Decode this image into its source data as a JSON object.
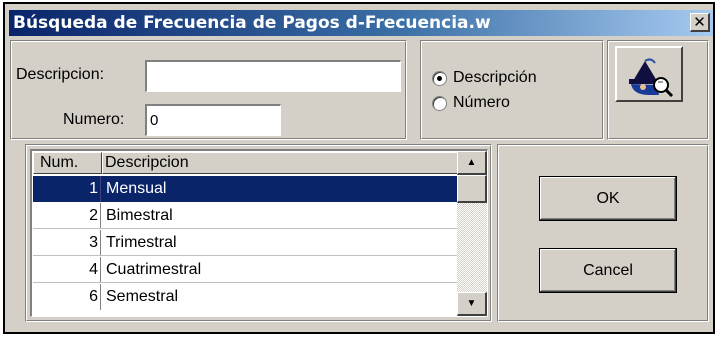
{
  "window": {
    "title": "Búsqueda de Frecuencia de Pagos  d-Frecuencia.w",
    "close_glyph": "✕"
  },
  "search": {
    "descripcion_label": "Descripcion:",
    "descripcion_value": "",
    "numero_label": "Numero:",
    "numero_value": "0"
  },
  "sort_options": [
    {
      "label": "Descripción",
      "selected": true
    },
    {
      "label": "Número",
      "selected": false
    }
  ],
  "icon_button": {
    "icon": "detective-search-icon"
  },
  "table": {
    "columns": [
      "Num.",
      "Descripcion"
    ],
    "rows": [
      {
        "num": "1",
        "desc": "Mensual",
        "selected": true
      },
      {
        "num": "2",
        "desc": "Bimestral",
        "selected": false
      },
      {
        "num": "3",
        "desc": "Trimestral",
        "selected": false
      },
      {
        "num": "4",
        "desc": "Cuatrimestral",
        "selected": false
      },
      {
        "num": "6",
        "desc": "Semestral",
        "selected": false
      }
    ]
  },
  "buttons": {
    "ok": "OK",
    "cancel": "Cancel"
  },
  "colors": {
    "titlebar_start": "#0a246a",
    "selection": "#0a246a",
    "face": "#d4d0c8"
  }
}
